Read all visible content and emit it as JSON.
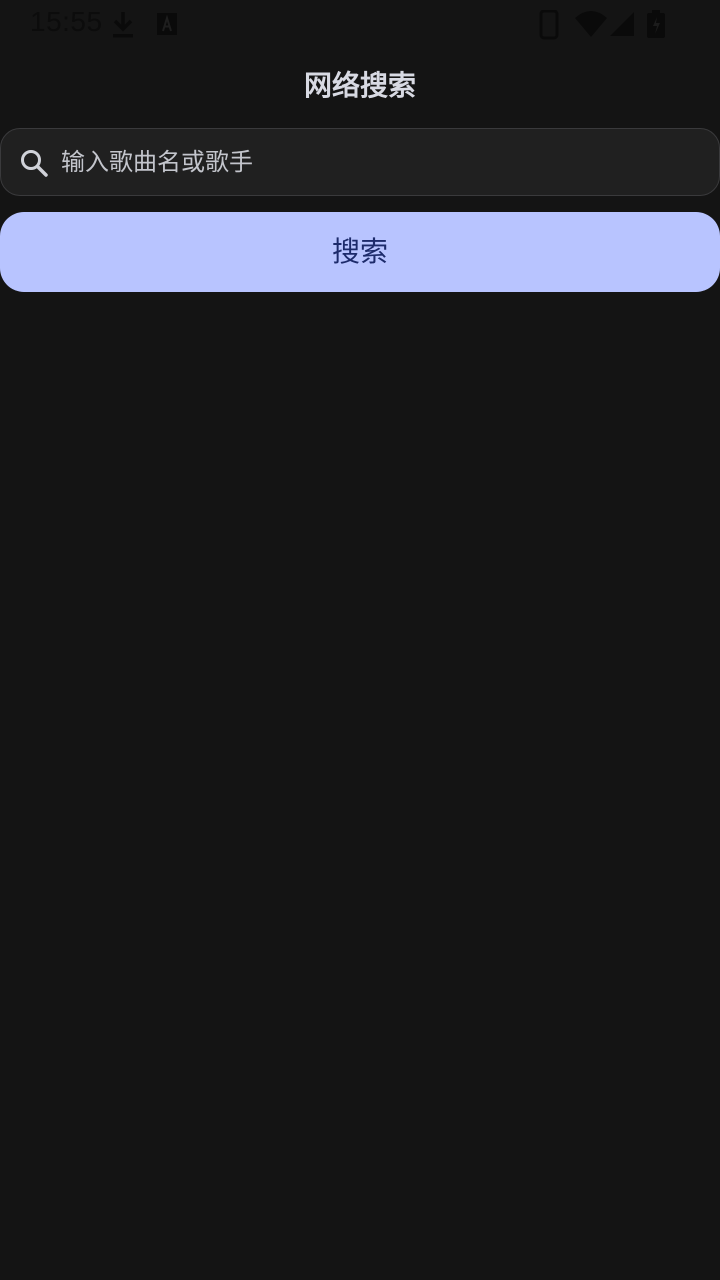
{
  "status_bar": {
    "time": "15:55",
    "icons": [
      "download-icon",
      "a-notification-icon",
      "phone-icon",
      "wifi-icon",
      "cell-signal-icon",
      "battery-icon"
    ]
  },
  "header": {
    "title": "网络搜索"
  },
  "search": {
    "placeholder": "输入歌曲名或歌手",
    "icon": "search-icon",
    "button_label": "搜索"
  },
  "colors": {
    "background": "#141414",
    "accent": "#b8c4ff",
    "accent_text": "#1d2b6b"
  }
}
